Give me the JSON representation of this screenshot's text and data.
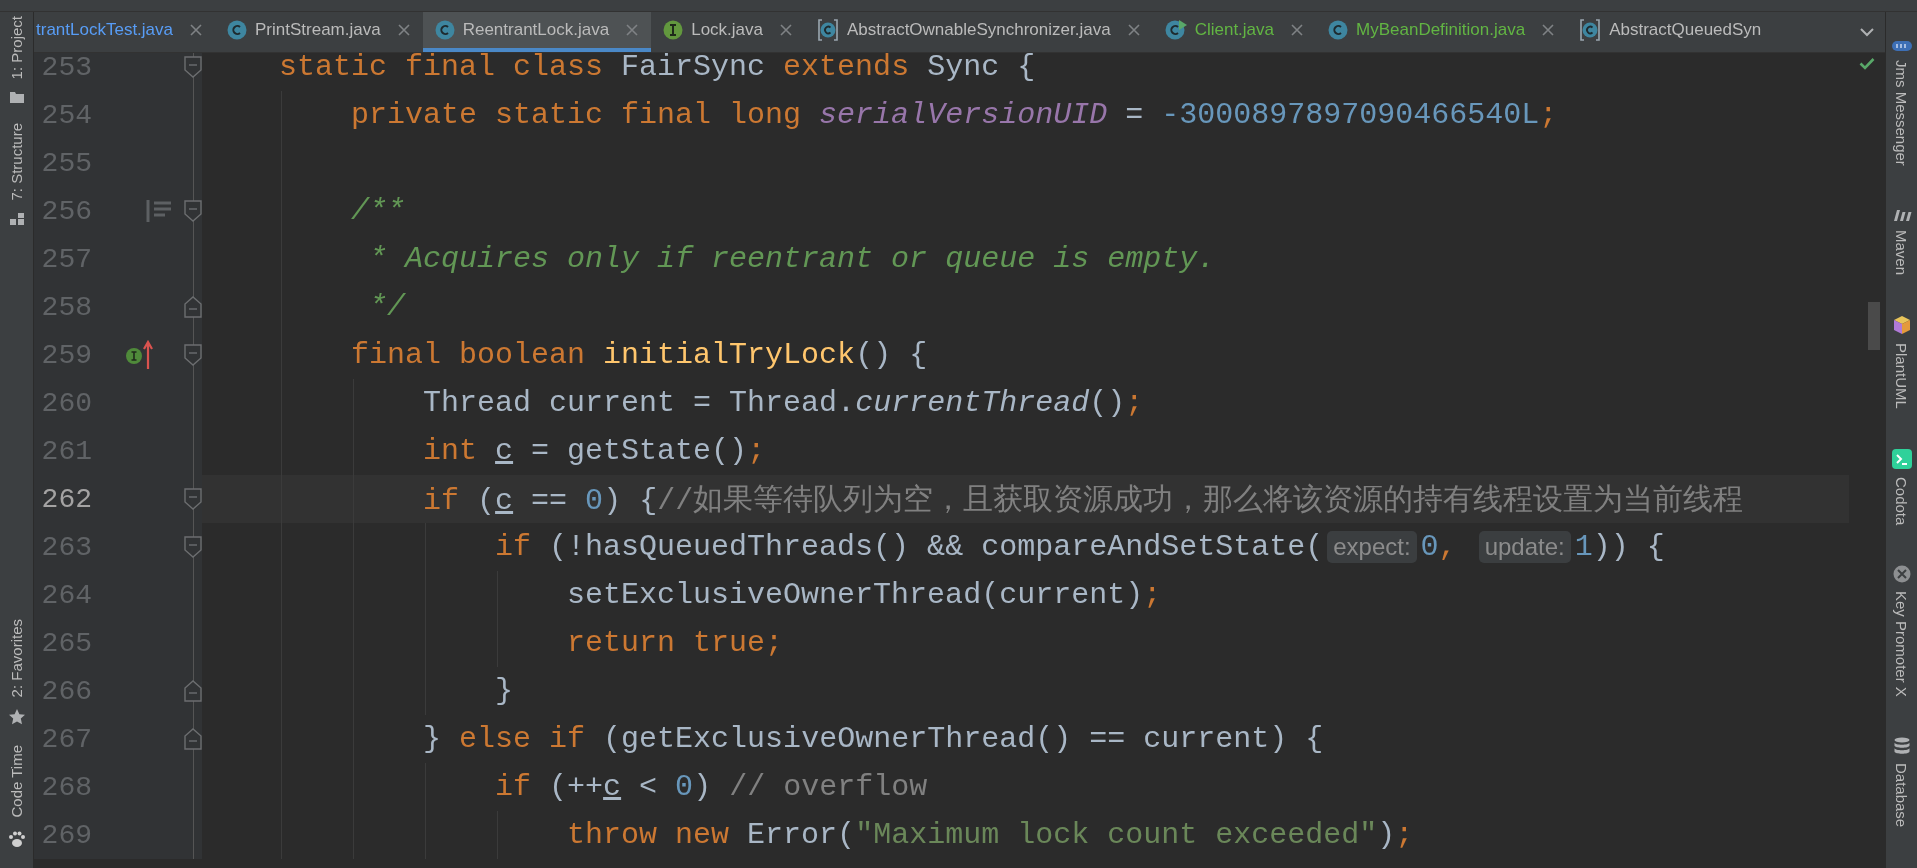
{
  "left_tools": [
    {
      "label": "1: Project",
      "kind": "folder"
    },
    {
      "label": "7: Structure",
      "kind": "structure"
    },
    {
      "label": "2: Favorites",
      "kind": "star"
    },
    {
      "label": "Code Time",
      "kind": "paw"
    }
  ],
  "tabs": [
    {
      "label": "trantLockTest.java",
      "kind": "plain",
      "color": "#589df6",
      "selected": false,
      "closable": true
    },
    {
      "label": "PrintStream.java",
      "kind": "class",
      "color": "#bbbbbb",
      "selected": false,
      "closable": true
    },
    {
      "label": "ReentrantLock.java",
      "kind": "class",
      "color": "#bbbbbb",
      "selected": true,
      "closable": true
    },
    {
      "label": "Lock.java",
      "kind": "interface",
      "color": "#bbbbbb",
      "selected": false,
      "closable": true
    },
    {
      "label": "AbstractOwnableSynchronizer.java",
      "kind": "abstract",
      "color": "#bbbbbb",
      "selected": false,
      "closable": true
    },
    {
      "label": "Client.java",
      "kind": "runnable",
      "color": "#62b543",
      "selected": false,
      "closable": true
    },
    {
      "label": "MyBeanDefinition.java",
      "kind": "class",
      "color": "#62b543",
      "selected": false,
      "closable": true
    },
    {
      "label": "AbstractQueuedSyn",
      "kind": "abstract",
      "color": "#bbbbbb",
      "selected": false,
      "closable": false
    }
  ],
  "lines": [
    {
      "number": "253",
      "kind": "plain",
      "current": false,
      "fold_start": true,
      "fold_end": false,
      "tokens": [
        {
          "kind": "kw",
          "text": "    static final class "
        },
        {
          "kind": "plain",
          "text": "FairSync "
        },
        {
          "kind": "kw",
          "text": "extends "
        },
        {
          "kind": "plain",
          "text": "Sync {"
        }
      ]
    },
    {
      "number": "254",
      "kind": "plain",
      "current": false,
      "fold_start": false,
      "fold_end": false,
      "tokens": [
        {
          "kind": "kw",
          "text": "        private static final long "
        },
        {
          "kind": "field",
          "text": "serialVersionUID"
        },
        {
          "kind": "plain",
          "text": " = "
        },
        {
          "kind": "num",
          "text": "-3000897897090466540L"
        },
        {
          "kind": "kw",
          "text": ";"
        }
      ]
    },
    {
      "number": "255",
      "kind": "plain",
      "current": false,
      "fold_start": false,
      "fold_end": false
    },
    {
      "number": "256",
      "kind": "doc",
      "current": false,
      "fold_start": true,
      "fold_end": false,
      "tokens": [
        {
          "kind": "doc",
          "text": "        /**"
        }
      ]
    },
    {
      "number": "257",
      "kind": "plain",
      "current": false,
      "fold_start": false,
      "fold_end": false,
      "tokens": [
        {
          "kind": "doc",
          "text": "         * Acquires only if reentrant or queue is empty."
        }
      ]
    },
    {
      "number": "258",
      "kind": "plain",
      "current": false,
      "fold_start": false,
      "fold_end": true,
      "tokens": [
        {
          "kind": "doc",
          "text": "         */"
        }
      ]
    },
    {
      "number": "259",
      "kind": "implements",
      "current": false,
      "fold_start": true,
      "fold_end": false,
      "tokens": [
        {
          "kind": "kw",
          "text": "        final boolean "
        },
        {
          "kind": "method",
          "text": "initialTryLock"
        },
        {
          "kind": "plain",
          "text": "() {"
        }
      ]
    },
    {
      "number": "260",
      "kind": "plain",
      "current": false,
      "fold_start": false,
      "fold_end": false,
      "tokens": [
        {
          "kind": "plain",
          "text": "            Thread current = Thread."
        },
        {
          "kind": "static",
          "text": "currentThread"
        },
        {
          "kind": "plain",
          "text": "()"
        },
        {
          "kind": "kw",
          "text": ";"
        }
      ]
    },
    {
      "number": "261",
      "kind": "plain",
      "current": false,
      "fold_start": false,
      "fold_end": false,
      "tokens": [
        {
          "kind": "kw",
          "text": "            int "
        },
        {
          "kind": "var",
          "text": "c"
        },
        {
          "kind": "plain",
          "text": " = getState()"
        },
        {
          "kind": "kw",
          "text": ";"
        }
      ]
    },
    {
      "number": "262",
      "kind": "plain",
      "current": true,
      "fold_start": true,
      "fold_end": false,
      "tokens": [
        {
          "kind": "kw",
          "text": "            if "
        },
        {
          "kind": "plain",
          "text": "("
        },
        {
          "kind": "var",
          "text": "c"
        },
        {
          "kind": "plain",
          "text": " == "
        },
        {
          "kind": "num",
          "text": "0"
        },
        {
          "kind": "plain",
          "text": ") {"
        },
        {
          "kind": "comment",
          "text": "//如果等待队列为空，且获取资源成功，那么将该资源的持有线程设置为当前线程"
        }
      ]
    },
    {
      "number": "263",
      "kind": "plain",
      "current": false,
      "fold_start": true,
      "fold_end": false,
      "tokens": [
        {
          "kind": "kw",
          "text": "                if "
        },
        {
          "kind": "plain",
          "text": "(!hasQueuedThreads() && compareAndSetState("
        },
        {
          "kind": "hint",
          "text": "expect:"
        },
        {
          "kind": "num",
          "text": "0"
        },
        {
          "kind": "kw",
          "text": ", "
        },
        {
          "kind": "hint",
          "text": "update:"
        },
        {
          "kind": "num",
          "text": "1"
        },
        {
          "kind": "plain",
          "text": ")) {"
        }
      ]
    },
    {
      "number": "264",
      "kind": "plain",
      "current": false,
      "fold_start": false,
      "fold_end": false,
      "tokens": [
        {
          "kind": "plain",
          "text": "                    setExclusiveOwnerThread(current)"
        },
        {
          "kind": "kw",
          "text": ";"
        }
      ]
    },
    {
      "number": "265",
      "kind": "plain",
      "current": false,
      "fold_start": false,
      "fold_end": false,
      "tokens": [
        {
          "kind": "kw",
          "text": "                    return true;"
        }
      ]
    },
    {
      "number": "266",
      "kind": "plain",
      "current": false,
      "fold_start": false,
      "fold_end": true,
      "tokens": [
        {
          "kind": "plain",
          "text": "                }"
        }
      ]
    },
    {
      "number": "267",
      "kind": "plain",
      "current": false,
      "fold_start": false,
      "fold_end": true,
      "tokens": [
        {
          "kind": "plain",
          "text": "            } "
        },
        {
          "kind": "kw",
          "text": "else if "
        },
        {
          "kind": "plain",
          "text": "(getExclusiveOwnerThread() == current) {"
        }
      ]
    },
    {
      "number": "268",
      "kind": "plain",
      "current": false,
      "fold_start": false,
      "fold_end": false,
      "tokens": [
        {
          "kind": "kw",
          "text": "                if "
        },
        {
          "kind": "plain",
          "text": "(++"
        },
        {
          "kind": "var",
          "text": "c"
        },
        {
          "kind": "plain",
          "text": " < "
        },
        {
          "kind": "num",
          "text": "0"
        },
        {
          "kind": "plain",
          "text": ") "
        },
        {
          "kind": "comment",
          "text": "// overflow"
        }
      ]
    },
    {
      "number": "269",
      "kind": "plain",
      "current": false,
      "fold_start": false,
      "fold_end": false,
      "tokens": [
        {
          "kind": "kw",
          "text": "                    throw new "
        },
        {
          "kind": "plain",
          "text": "Error("
        },
        {
          "kind": "str",
          "text": "\"Maximum lock count exceeded\""
        },
        {
          "kind": "plain",
          "text": ")"
        },
        {
          "kind": "kw",
          "text": ";"
        }
      ]
    }
  ],
  "right_tools": [
    {
      "label": "Jms Messenger",
      "kind": "jms"
    },
    {
      "label": "Maven",
      "kind": "maven"
    },
    {
      "label": "PlantUML",
      "kind": "plantuml"
    },
    {
      "label": "Codota",
      "kind": "codota"
    },
    {
      "label": "Key Promoter X",
      "kind": "keypromoter"
    },
    {
      "label": "Database",
      "kind": "database"
    }
  ]
}
